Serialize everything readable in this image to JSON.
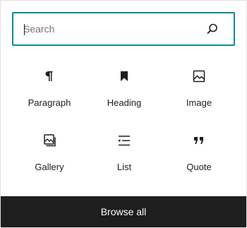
{
  "search": {
    "placeholder": "Search",
    "icon": "search-icon"
  },
  "blocks": [
    {
      "label": "Paragraph",
      "icon": "paragraph-icon"
    },
    {
      "label": "Heading",
      "icon": "heading-bookmark-icon"
    },
    {
      "label": "Image",
      "icon": "image-icon"
    },
    {
      "label": "Gallery",
      "icon": "gallery-icon"
    },
    {
      "label": "List",
      "icon": "list-icon"
    },
    {
      "label": "Quote",
      "icon": "quote-icon"
    }
  ],
  "footer": {
    "browse_all_label": "Browse all"
  },
  "colors": {
    "accent": "#0b8b99",
    "text": "#1e1e1e",
    "footer_bg": "#1e1e1e",
    "footer_text": "#ffffff",
    "border": "#e0e0e0"
  }
}
